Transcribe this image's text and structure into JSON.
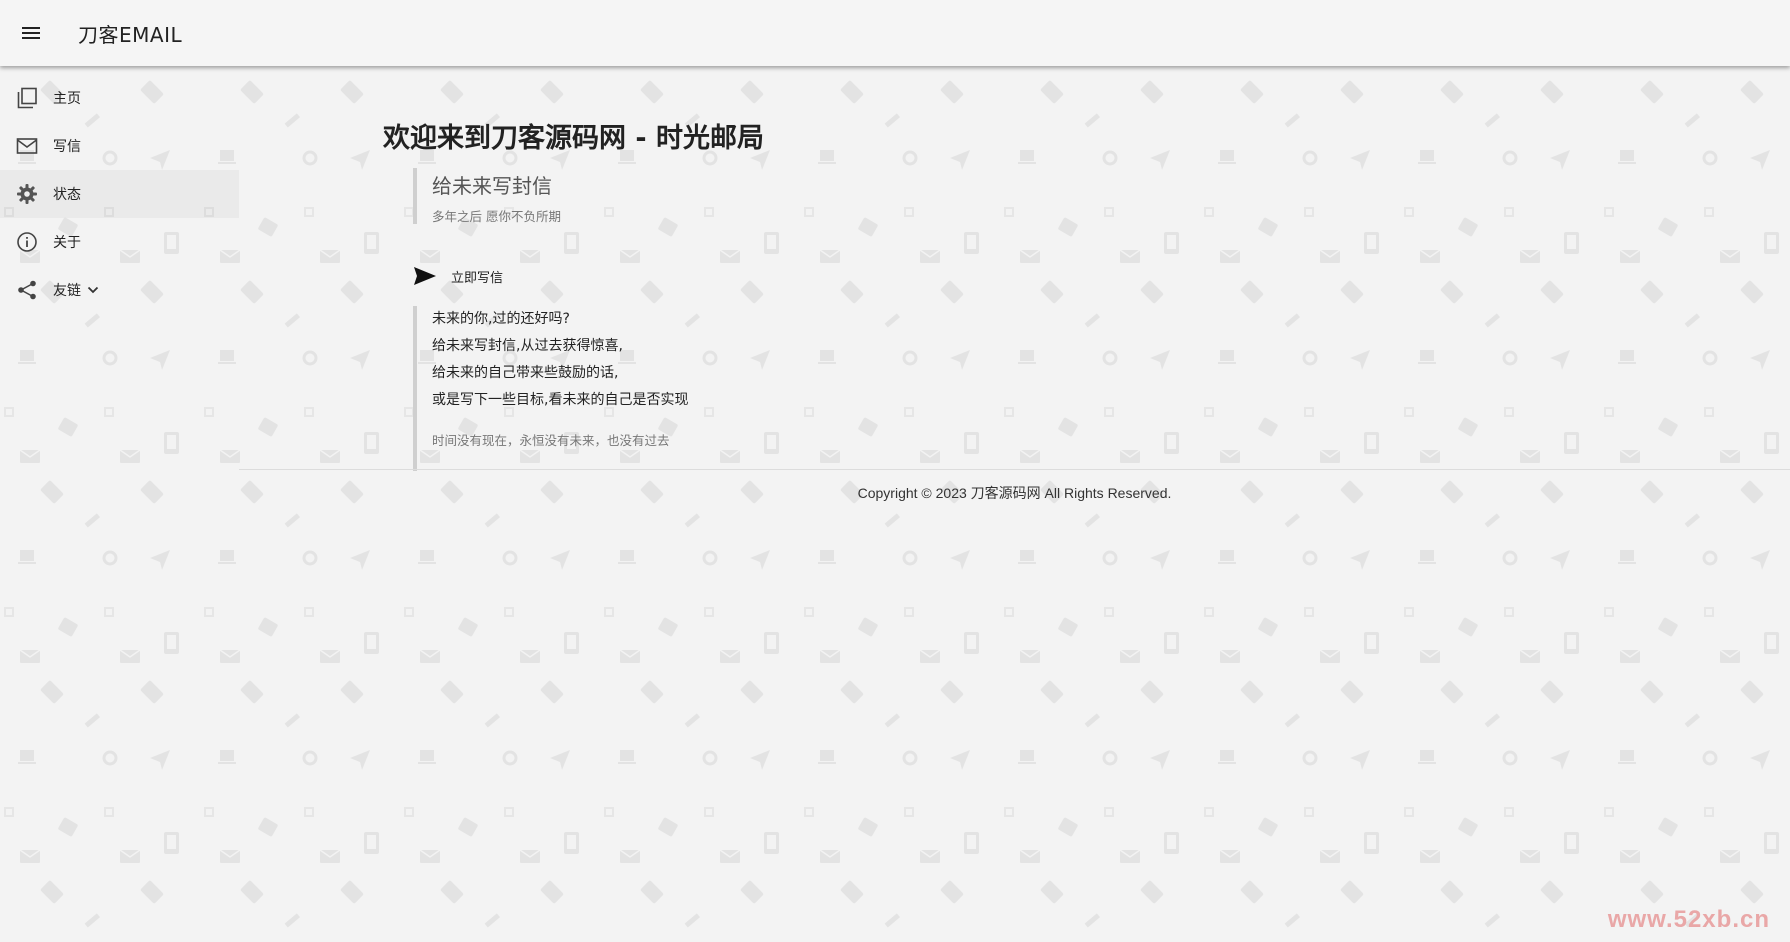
{
  "header": {
    "brand": "刀客EMAIL",
    "menu_icon": "menu-icon"
  },
  "sidebar": {
    "items": [
      {
        "label": "主页",
        "icon": "pages-icon"
      },
      {
        "label": "写信",
        "icon": "mail-icon"
      },
      {
        "label": "状态",
        "icon": "gear-icon",
        "active": true
      },
      {
        "label": "关于",
        "icon": "info-icon"
      },
      {
        "label": "友链",
        "icon": "share-icon",
        "has_dropdown": true
      }
    ]
  },
  "main": {
    "welcome": "欢迎来到刀客源码网 - 时光邮局",
    "quote1": {
      "title": "给未来写封信",
      "subtitle": "多年之后 愿你不负所期"
    },
    "write_button": {
      "label": "立即写信",
      "icon": "send-icon"
    },
    "quote2": {
      "lines": [
        "未来的你,过的还好吗?",
        "给未来写封信,从过去获得惊喜,",
        "给未来的自己带来些鼓励的话,",
        "或是写下一些目标,看未来的自己是否实现"
      ],
      "footer": "时间没有现在，永恒没有未来，也没有过去"
    },
    "copyright": "Copyright © 2023 刀客源码网 All Rights Reserved."
  },
  "watermark": "www.52xb.cn",
  "colors": {
    "background": "#f3f3f3",
    "appbar": "#f5f5f5",
    "quote_border": "#cfcfcf",
    "watermark": "#e9a7a7"
  }
}
